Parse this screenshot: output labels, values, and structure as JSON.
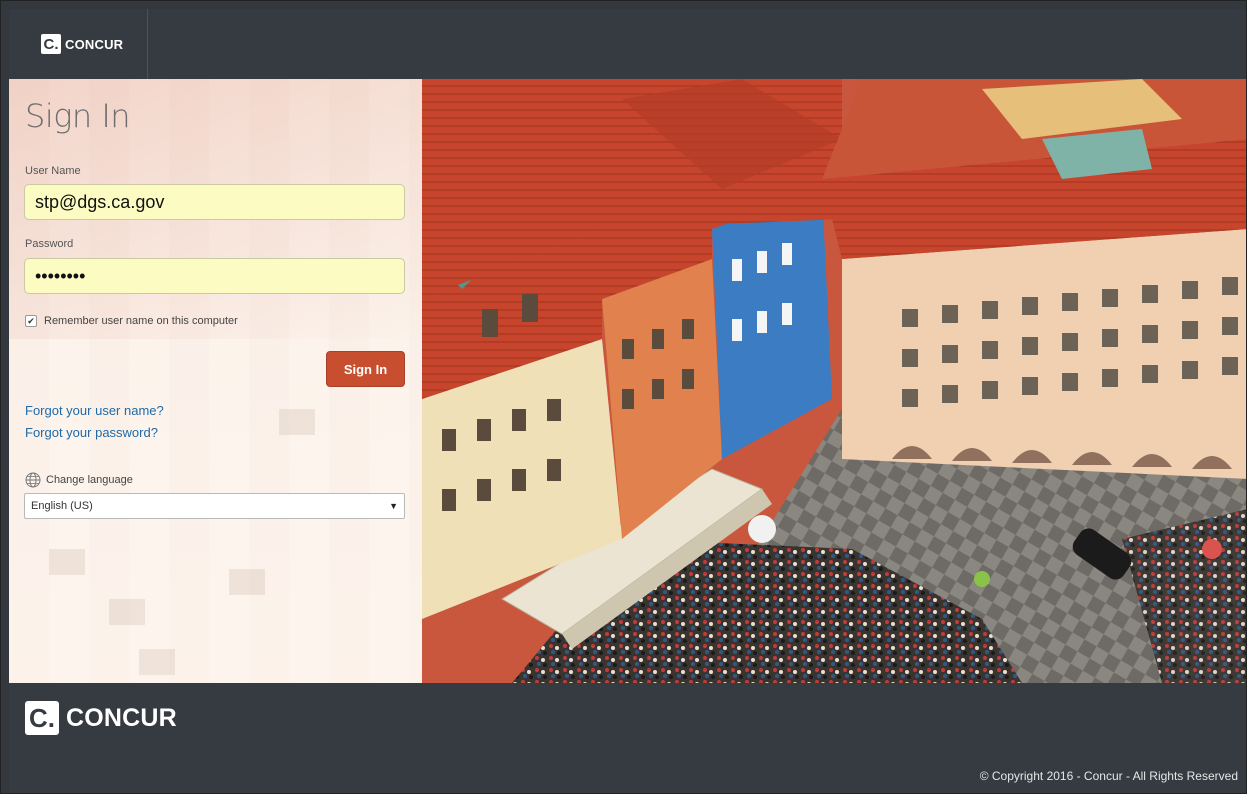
{
  "brand": {
    "logo_mark": "C.",
    "logo_text": "CONCUR"
  },
  "form": {
    "title": "Sign In",
    "username_label": "User Name",
    "username_value": "stp@dgs.ca.gov",
    "password_label": "Password",
    "password_value": "••••••••",
    "remember_label": "Remember user name on this computer",
    "remember_checked": true,
    "signin_label": "Sign In",
    "forgot_username": "Forgot your user name?",
    "forgot_password": "Forgot your password?",
    "change_language_label": "Change language",
    "language_selected": "English (US)"
  },
  "footer": {
    "copyright": "© Copyright 2016 - Concur - All Rights Reserved"
  },
  "icons": {
    "checkbox": "checkmark-icon",
    "globe": "globe-icon",
    "dropdown": "caret-down-icon"
  },
  "colors": {
    "header_bg": "#363b41",
    "signin_button": "#c74f2f",
    "input_autofill": "#fcfcc2",
    "link": "#1f6aa8"
  }
}
